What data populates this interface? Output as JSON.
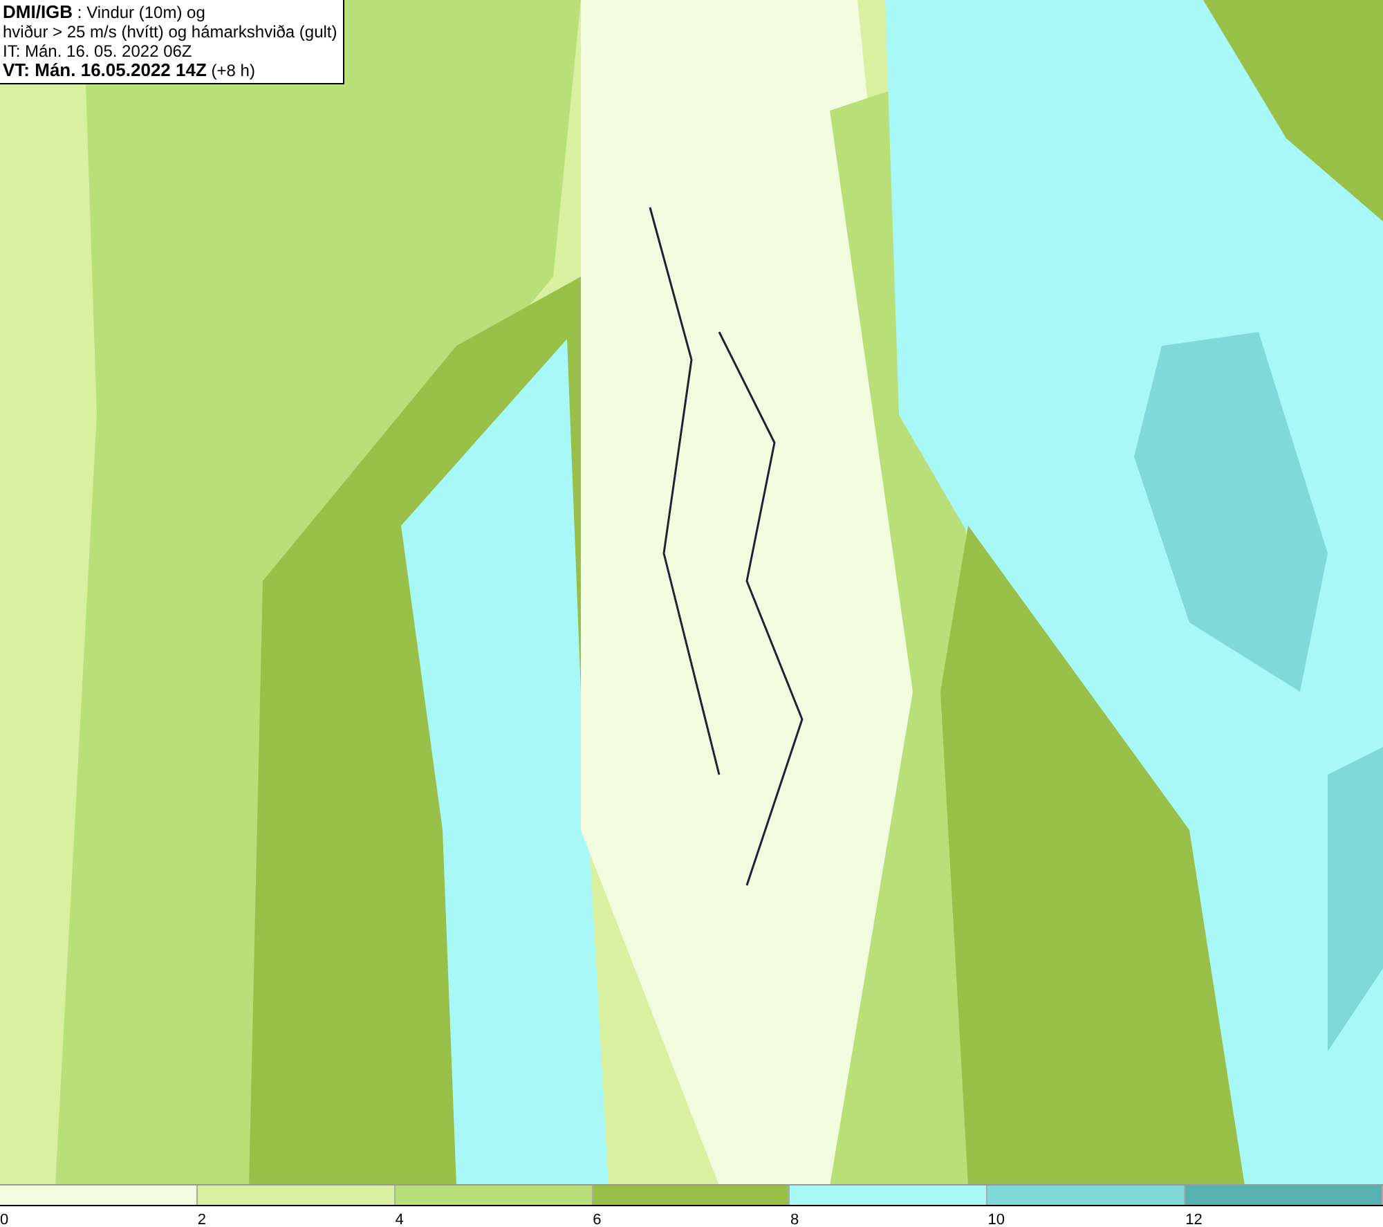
{
  "header": {
    "lines": [
      "**DMI/IGB** : Vindur (10m) og",
      "hviður > 25 m/s (hvítt) og hámarkshviða (gult)",
      "IT: Mán. 16. 05. 2022 06Z",
      "**VT: Mán. 16.05.2022 14Z** (+8 h)"
    ]
  },
  "legend": {
    "bins": [
      {
        "color": "#f2fde0"
      },
      {
        "color": "#d8f0a0"
      },
      {
        "color": "#b8df78"
      },
      {
        "color": "#98c048"
      },
      {
        "color": "#a8f8f8"
      },
      {
        "color": "#80d8d8"
      },
      {
        "color": "#58b0b0"
      }
    ],
    "ticks": [
      "0",
      "2",
      "4",
      "6",
      "8",
      "10",
      "12"
    ]
  }
}
